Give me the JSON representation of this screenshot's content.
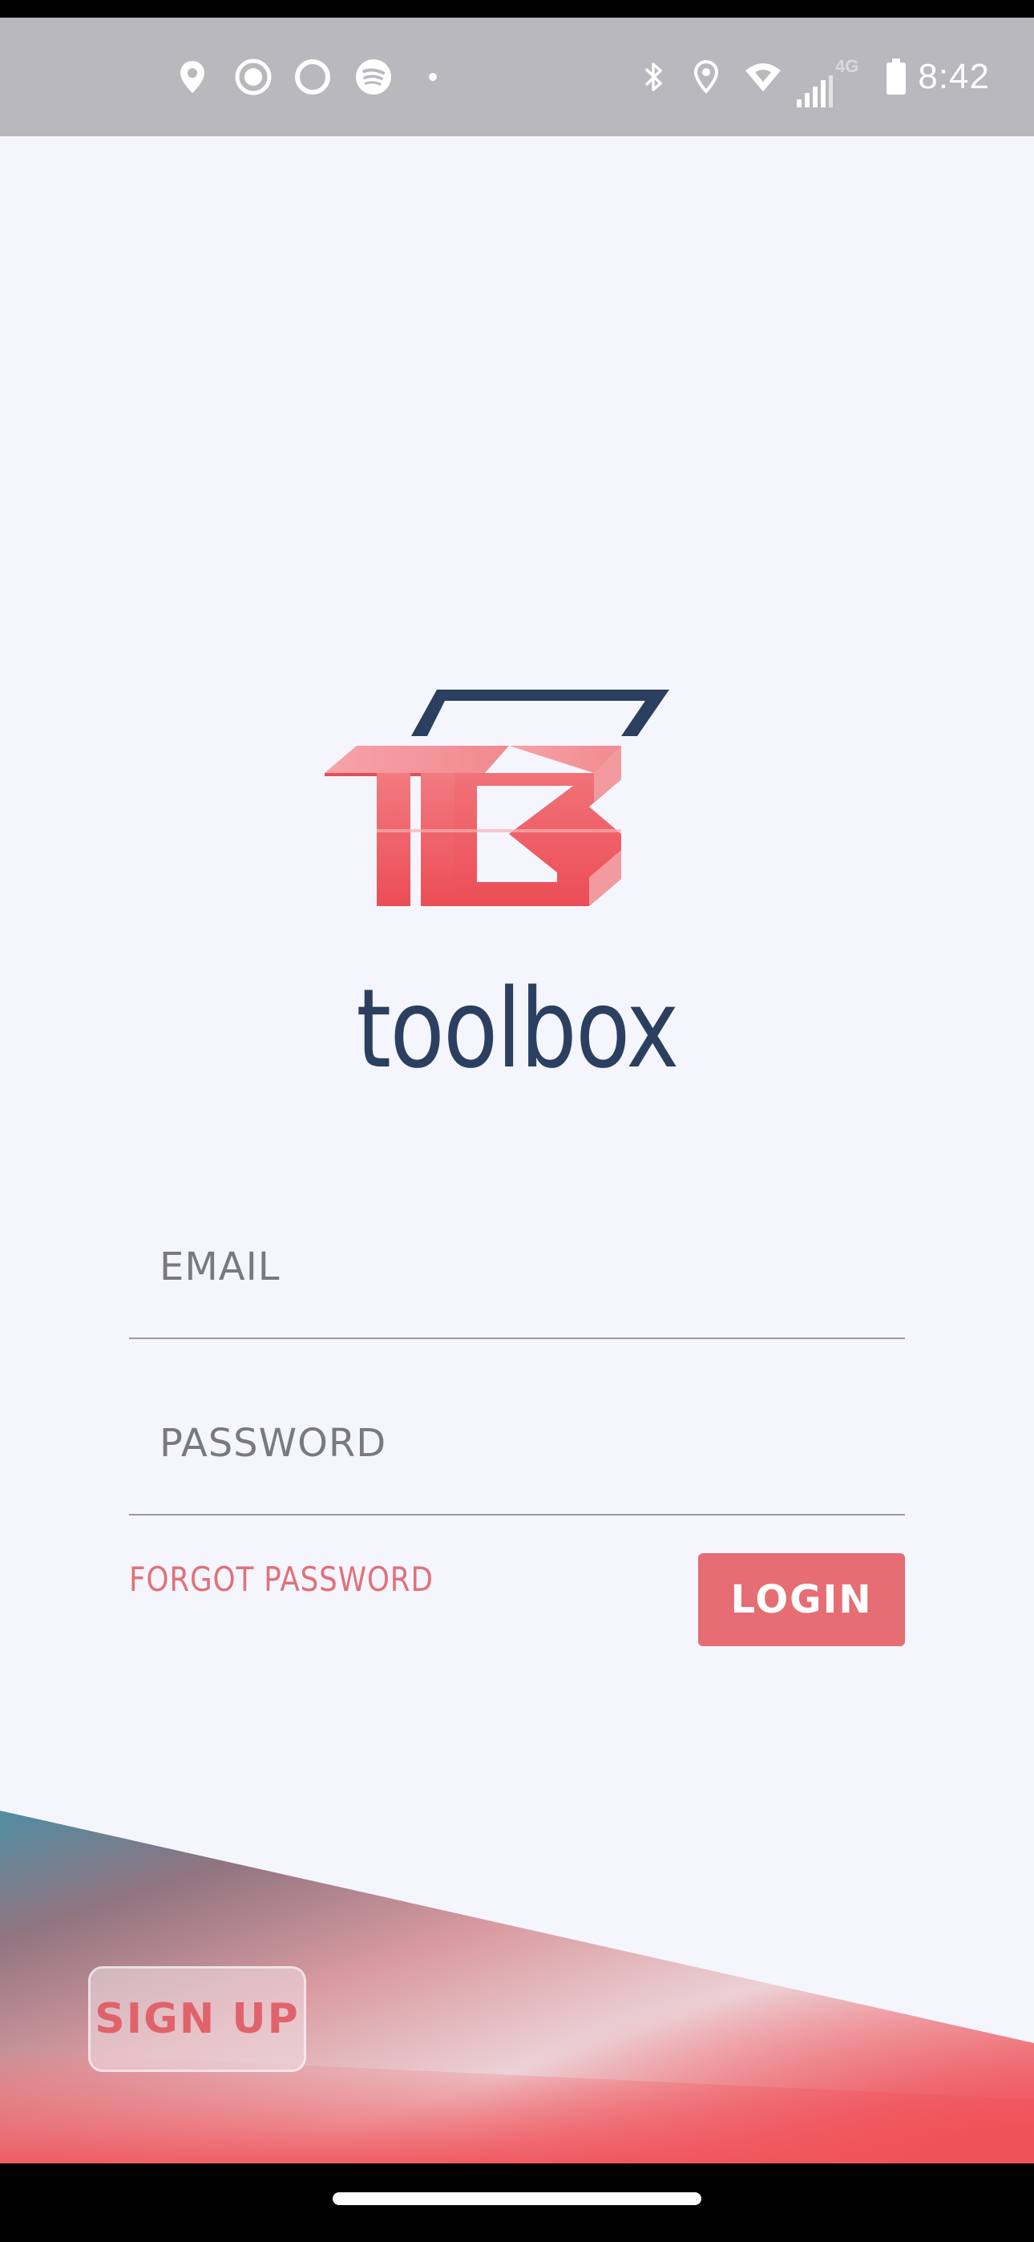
{
  "status_bar": {
    "time": "8:42",
    "network": "4G",
    "left_icons": [
      "location-pin-icon",
      "record-icon",
      "alexa-ring-icon",
      "spotify-icon",
      "dot-icon"
    ],
    "right_icons": [
      "bluetooth-icon",
      "location-outline-icon",
      "wifi-icon",
      "signal-icon",
      "battery-icon"
    ]
  },
  "brand": {
    "name": "toolbox",
    "logo_colors": {
      "primary": "#ef5a62",
      "handle": "#2b4060"
    }
  },
  "form": {
    "email_placeholder": "EMAIL",
    "email_value": "",
    "password_placeholder": "PASSWORD",
    "password_value": "",
    "forgot_label": "FORGOT PASSWORD",
    "login_label": "LOGIN"
  },
  "footer": {
    "signup_label": "SIGN UP"
  },
  "colors": {
    "background": "#f5f6fd",
    "accent": "#e56d73",
    "brand_text": "#2b4060",
    "wave_teal": "#4f8ea3",
    "wave_red": "#f0525a"
  }
}
